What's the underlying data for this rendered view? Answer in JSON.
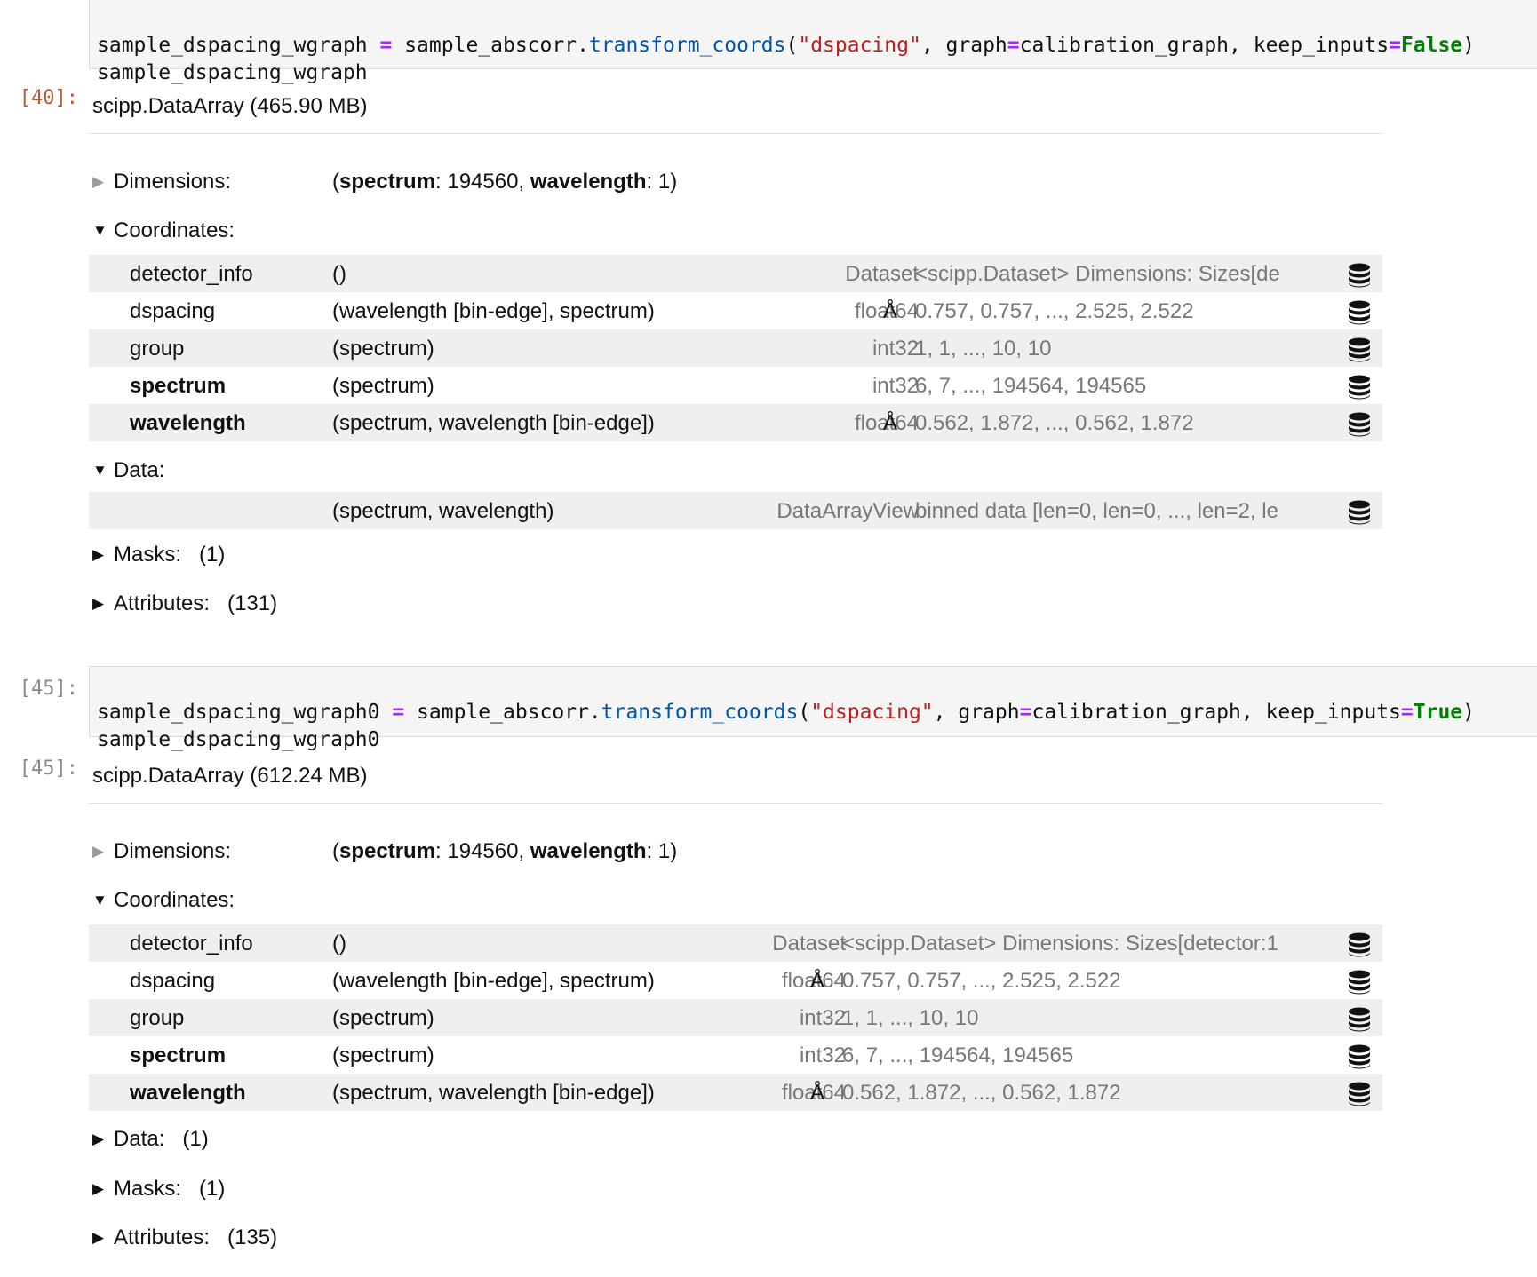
{
  "cell40": {
    "input_line1_tokens": [
      "sample_dspacing_wgraph ",
      "=",
      " sample_abscorr.",
      "transform_coords",
      "(",
      "\"dspacing\"",
      ", graph",
      "=",
      "calibration_graph, keep_inputs",
      "=",
      "False",
      ")"
    ],
    "input_line2": "sample_dspacing_wgraph",
    "out_prompt": "[40]:",
    "header": "scipp.DataArray (465.90 MB)",
    "dimensions_label": "Dimensions:",
    "dim_spectrum_name": "spectrum",
    "dim_spectrum_size": ": 194560, ",
    "dim_wavelength_name": "wavelength",
    "dim_wavelength_size": ": 1)",
    "dim_open": "(",
    "coordinates_label": "Coordinates:",
    "coords": [
      {
        "name": "detector_info",
        "dims": "()",
        "dtype": "Dataset",
        "unit": "",
        "values": "<scipp.Dataset> Dimensions: Sizes[de"
      },
      {
        "name": "dspacing",
        "dims": "(wavelength [bin-edge], spectrum)",
        "dtype": "float64",
        "unit": "Å",
        "values": "0.757, 0.757, ..., 2.525, 2.522"
      },
      {
        "name": "group",
        "dims": "(spectrum)",
        "dtype": "int32",
        "unit": "",
        "values": "1, 1, ..., 10, 10"
      },
      {
        "name": "spectrum",
        "dims": "(spectrum)",
        "dtype": "int32",
        "unit": "",
        "values": "6, 7, ..., 194564, 194565"
      },
      {
        "name": "wavelength",
        "dims": "(spectrum, wavelength [bin-edge])",
        "dtype": "float64",
        "unit": "Å",
        "values": "0.562, 1.872, ..., 0.562, 1.872"
      }
    ],
    "data_label": "Data:",
    "data_row": {
      "dims": "(spectrum, wavelength)",
      "dtype": "DataArrayView",
      "values": "binned data [len=0, len=0, ..., len=2, le"
    },
    "masks_label": "Masks:",
    "masks_count": "(1)",
    "attributes_label": "Attributes:",
    "attributes_count": "(131)"
  },
  "cell45": {
    "in_prompt": "[45]:",
    "input_line1_tokens": [
      "sample_dspacing_wgraph0 ",
      "=",
      " sample_abscorr.",
      "transform_coords",
      "(",
      "\"dspacing\"",
      ", graph",
      "=",
      "calibration_graph, keep_inputs",
      "=",
      "True",
      ")"
    ],
    "input_line2": "sample_dspacing_wgraph0",
    "out_prompt": "[45]:",
    "header": "scipp.DataArray (612.24 MB)",
    "dimensions_label": "Dimensions:",
    "dim_spectrum_name": "spectrum",
    "dim_spectrum_size": ": 194560, ",
    "dim_wavelength_name": "wavelength",
    "dim_wavelength_size": ": 1)",
    "dim_open": "(",
    "coordinates_label": "Coordinates:",
    "coords": [
      {
        "name": "detector_info",
        "dims": "()",
        "dtype": "Dataset",
        "unit": "",
        "values": "<scipp.Dataset> Dimensions: Sizes[detector:1"
      },
      {
        "name": "dspacing",
        "dims": "(wavelength [bin-edge], spectrum)",
        "dtype": "float64",
        "unit": "Å",
        "values": "0.757, 0.757, ..., 2.525, 2.522"
      },
      {
        "name": "group",
        "dims": "(spectrum)",
        "dtype": "int32",
        "unit": "",
        "values": "1, 1, ..., 10, 10"
      },
      {
        "name": "spectrum",
        "dims": "(spectrum)",
        "dtype": "int32",
        "unit": "",
        "values": "6, 7, ..., 194564, 194565"
      },
      {
        "name": "wavelength",
        "dims": "(spectrum, wavelength [bin-edge])",
        "dtype": "float64",
        "unit": "Å",
        "values": "0.562, 1.872, ..., 0.562, 1.872"
      }
    ],
    "data_label": "Data:",
    "data_count": "(1)",
    "masks_label": "Masks:",
    "masks_count": "(1)",
    "attributes_label": "Attributes:",
    "attributes_count": "(135)"
  }
}
